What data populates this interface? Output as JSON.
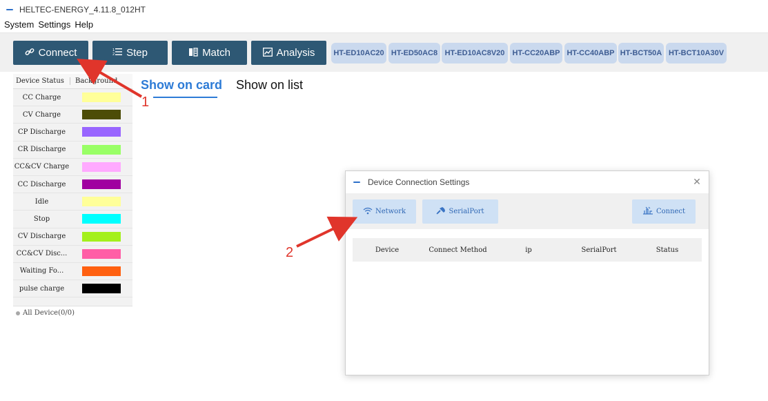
{
  "window": {
    "title": "HELTEC-ENERGY_4.11.8_012HT"
  },
  "menu": [
    "System",
    "Settings",
    "Help"
  ],
  "toolbar": {
    "connect": "Connect",
    "step": "Step",
    "match": "Match",
    "analysis": "Analysis",
    "device_tabs": [
      "HT-ED10AC20",
      "HT-ED50AC8",
      "HT-ED10AC8V20",
      "HT-CC20ABP",
      "HT-CC40ABP",
      "HT-BCT50A",
      "HT-BCT10A30V"
    ]
  },
  "left_panel": {
    "header_status": "Device Status",
    "header_background": "Background",
    "rows": [
      {
        "name": "CC Charge",
        "color": "#ffff99"
      },
      {
        "name": "CV Charge",
        "color": "#4c4c07"
      },
      {
        "name": "CP Discharge",
        "color": "#9966ff"
      },
      {
        "name": "CR Discharge",
        "color": "#99ff66"
      },
      {
        "name": "CC&CV Charge",
        "color": "#ffaaff"
      },
      {
        "name": "CC Discharge",
        "color": "#a000a0"
      },
      {
        "name": "Idle",
        "color": "#ffff99"
      },
      {
        "name": "Stop",
        "color": "#00ffff"
      },
      {
        "name": "CV Discharge",
        "color": "#a4f01c"
      },
      {
        "name": "CC&CV Disc...",
        "color": "#ff5ea6"
      },
      {
        "name": "Waiting Fo...",
        "color": "#ff6010"
      },
      {
        "name": "pulse charge",
        "color": "#000000"
      }
    ],
    "all_device": "All Device(0/0)"
  },
  "main": {
    "show_card": "Show on card",
    "show_list": "Show on list"
  },
  "annotations": {
    "n1": "1",
    "n2": "2",
    "color": "#e0352b"
  },
  "dialog": {
    "title": "Device Connection Settings",
    "network": "Network",
    "serial": "SerialPort",
    "connect": "Connect",
    "columns": [
      "Device",
      "Connect Method",
      "ip",
      "SerialPort",
      "Status"
    ]
  }
}
